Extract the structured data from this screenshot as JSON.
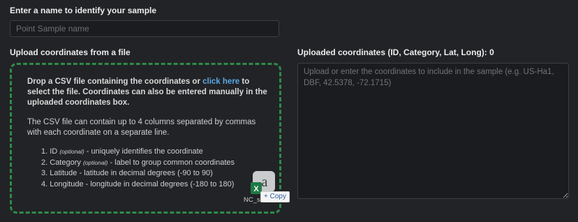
{
  "name_section": {
    "label": "Enter a name to identify your sample",
    "placeholder": "Point Sample name",
    "value": ""
  },
  "upload_section": {
    "label": "Upload coordinates from a file",
    "drop_text_before": "Drop a CSV file containing the coordinates or ",
    "click_here": "click here",
    "drop_text_after": " to select the file. Coordinates can also be entered manually in the uploaded coordinates box.",
    "csv_info": "The CSV file can contain up to 4 columns separated by commas with each coordinate on a separate line.",
    "columns": [
      {
        "num": "1.",
        "name": "ID",
        "optional": "(optional)",
        "desc": " - uniquely identifies the coordinate"
      },
      {
        "num": "2.",
        "name": "Category",
        "optional": "(optional)",
        "desc": " - label to group common coordinates"
      },
      {
        "num": "3.",
        "name": "Latitude",
        "optional": "",
        "desc": " - latitude in decimal degrees (-90 to 90)"
      },
      {
        "num": "4.",
        "name": "Longitude",
        "optional": "",
        "desc": " - longitude in decimal degrees (-180 to 180)"
      }
    ],
    "drag_file_name": "NC_s",
    "copy_badge": "+ Copy",
    "border_color": "#2e8b4a",
    "link_color": "#5aa8e6"
  },
  "coords_section": {
    "label": "Uploaded coordinates (ID, Category, Lat, Long): 0",
    "placeholder": "Upload or enter the coordinates to include in the sample (e.g. US-Ha1, DBF, 42.5378, -72.1715)",
    "value": ""
  },
  "icons": {
    "drag_file": "excel-file-icon"
  }
}
